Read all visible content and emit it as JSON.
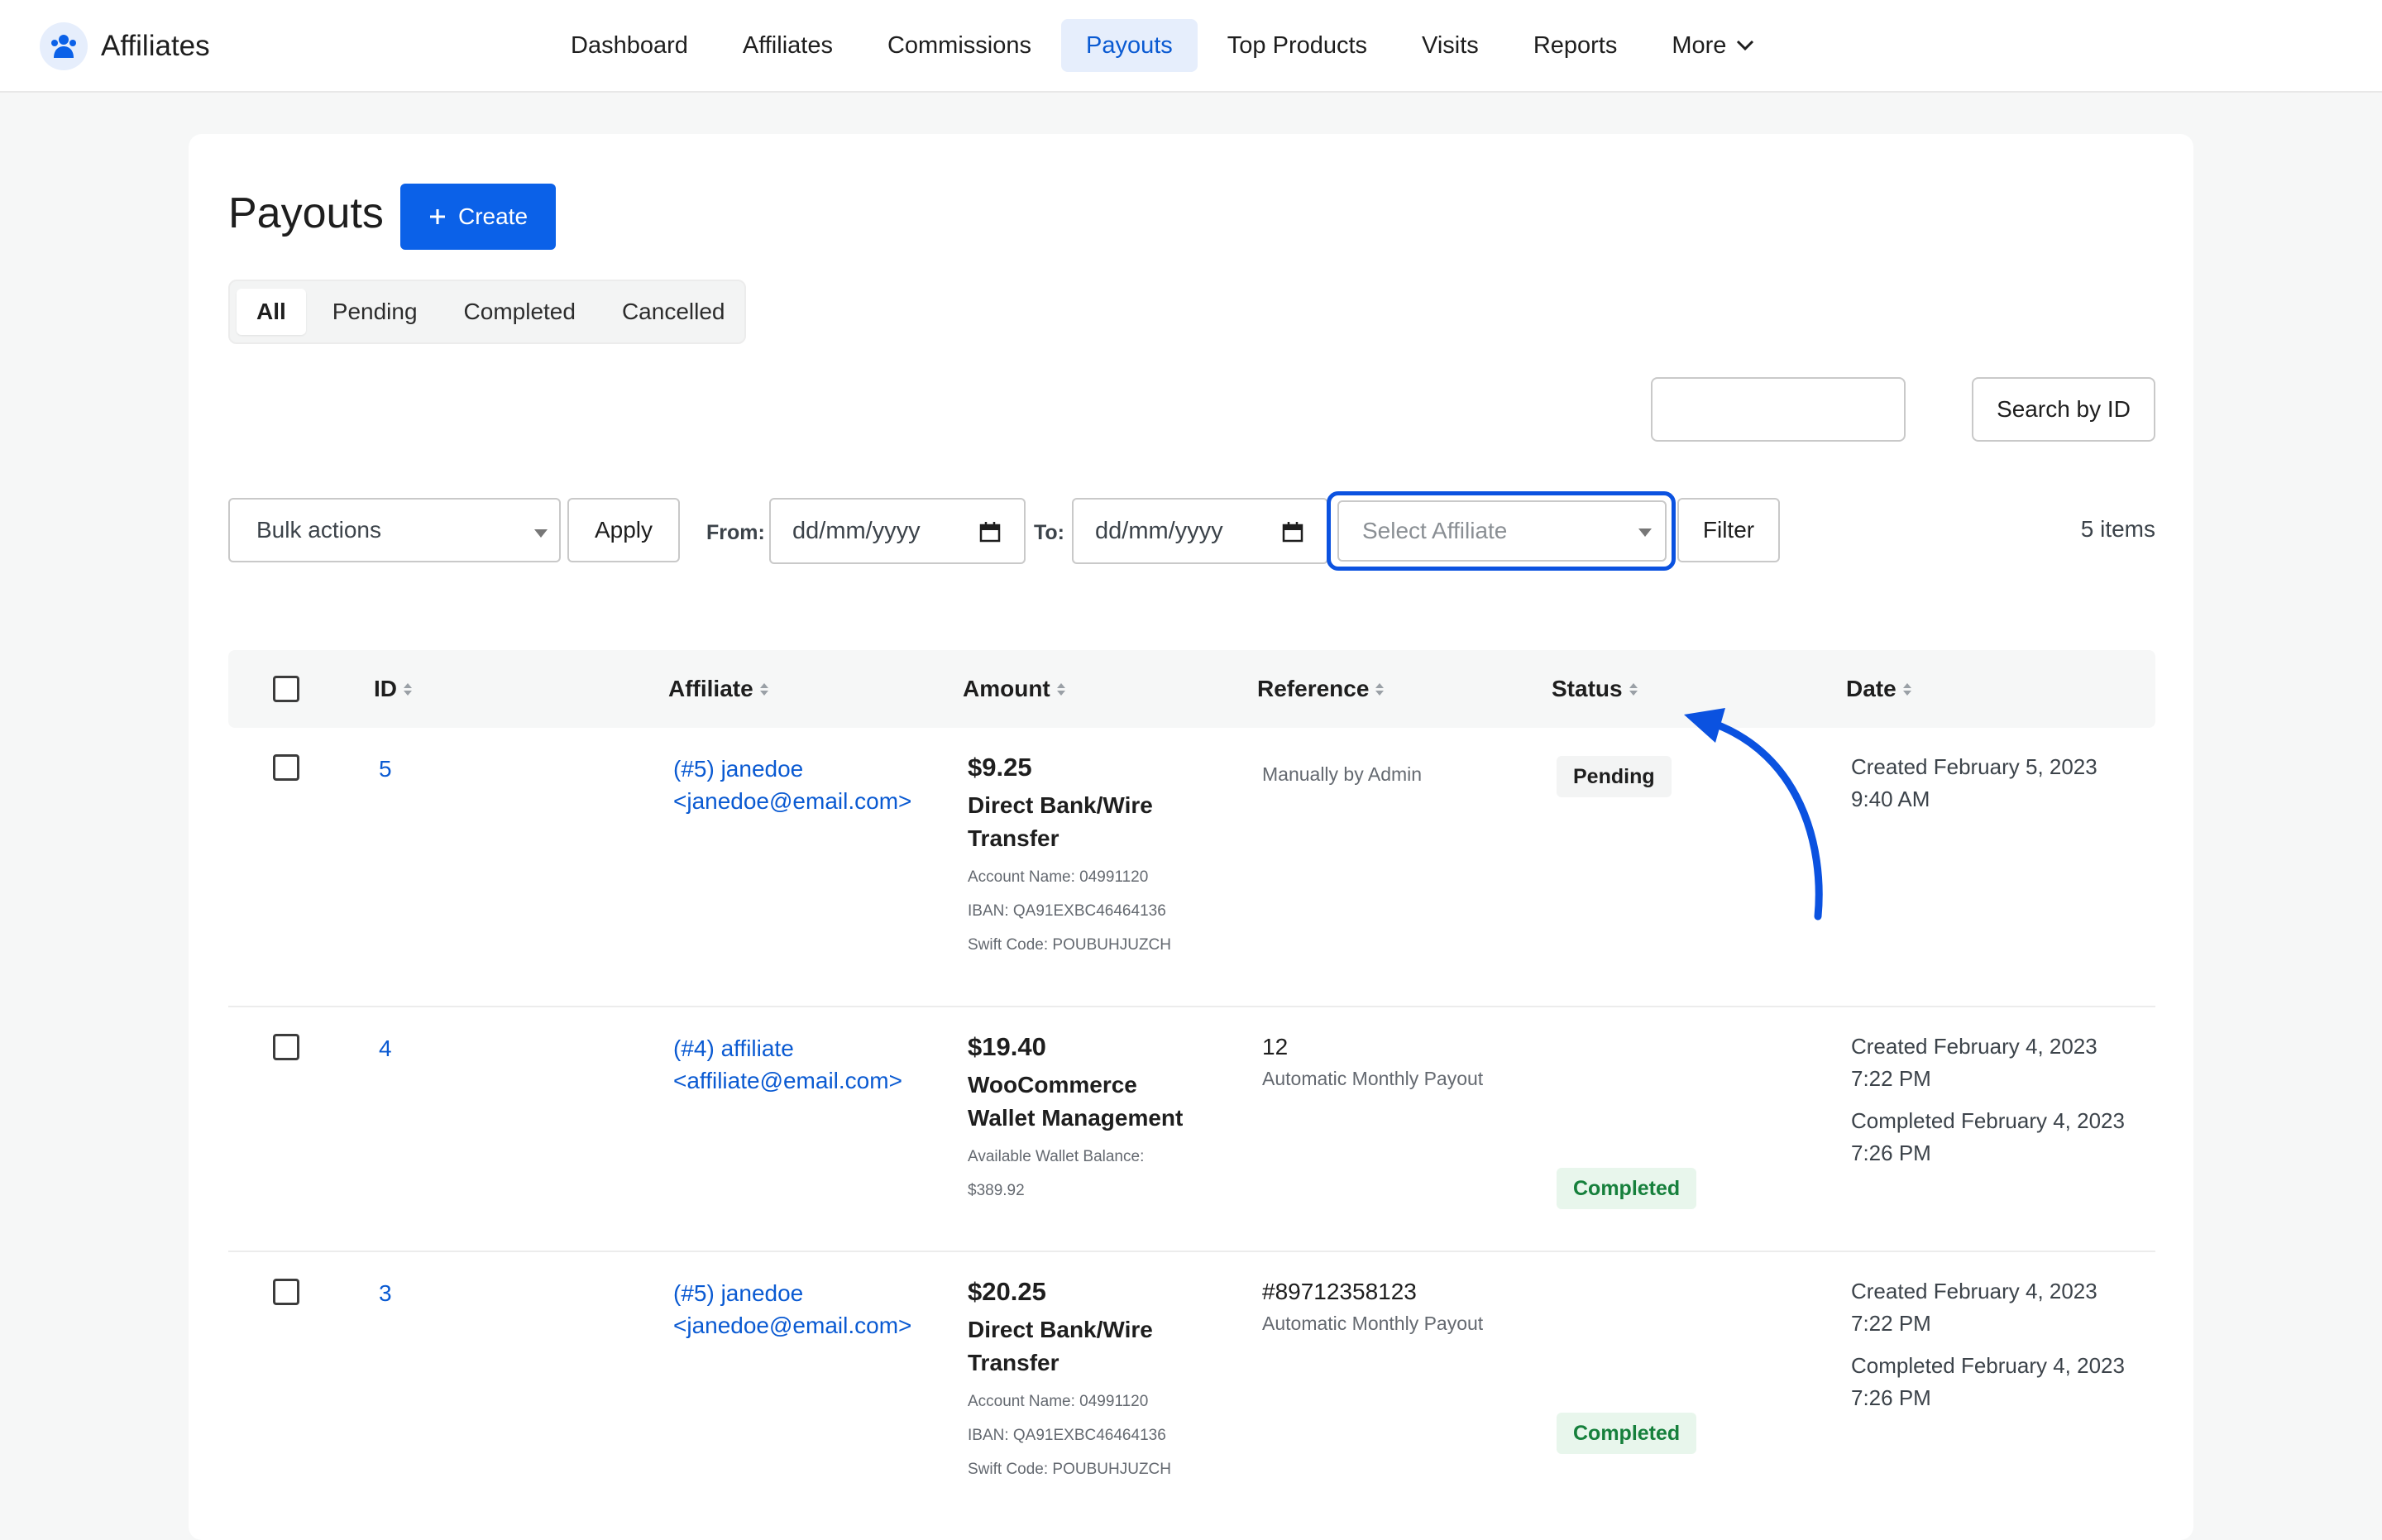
{
  "app": {
    "name": "Affiliates"
  },
  "nav": {
    "items": [
      "Dashboard",
      "Affiliates",
      "Commissions",
      "Payouts",
      "Top Products",
      "Visits",
      "Reports",
      "More"
    ],
    "active": "Payouts"
  },
  "page": {
    "title": "Payouts",
    "create_label": "Create"
  },
  "tabs": [
    "All",
    "Pending",
    "Completed",
    "Cancelled"
  ],
  "search": {
    "value": "",
    "button_label": "Search by ID"
  },
  "filters": {
    "bulk_actions": "Bulk actions",
    "apply": "Apply",
    "from_label": "From:",
    "from_placeholder": "dd/mm/yyyy",
    "to_label": "To:",
    "to_placeholder": "dd/mm/yyyy",
    "affiliate_placeholder": "Select Affiliate",
    "filter": "Filter",
    "items_count": "5 items"
  },
  "table": {
    "columns": [
      "ID",
      "Affiliate",
      "Amount",
      "Reference",
      "Status",
      "Date"
    ],
    "rows": [
      {
        "id": "5",
        "affiliate_line1": "(#5) janedoe",
        "affiliate_line2": "<janedoe@email.com>",
        "amount": "$9.25",
        "method_line1": "Direct Bank/Wire",
        "method_line2": "Transfer",
        "meta": [
          "Account Name: 04991120",
          "IBAN: QA91EXBC46464136",
          "Swift Code: POUBUHJUZCH"
        ],
        "ref_main": "",
        "ref_sub": "Manually by Admin",
        "status": "Pending",
        "date": [
          "Created February 5, 2023",
          "9:40 AM"
        ]
      },
      {
        "id": "4",
        "affiliate_line1": "(#4) affiliate",
        "affiliate_line2": "<affiliate@email.com>",
        "amount": "$19.40",
        "method_line1": "WooCommerce",
        "method_line2": "Wallet Management",
        "meta": [
          "Available Wallet Balance:",
          "$389.92"
        ],
        "ref_main": "12",
        "ref_sub": "Automatic Monthly Payout",
        "status": "Completed",
        "date": [
          "Created February 4, 2023",
          "7:22 PM",
          "Completed February 4, 2023",
          "7:26 PM"
        ]
      },
      {
        "id": "3",
        "affiliate_line1": "(#5) janedoe",
        "affiliate_line2": "<janedoe@email.com>",
        "amount": "$20.25",
        "method_line1": "Direct Bank/Wire",
        "method_line2": "Transfer",
        "meta": [
          "Account Name: 04991120",
          "IBAN: QA91EXBC46464136",
          "Swift Code: POUBUHJUZCH"
        ],
        "ref_main": "#89712358123",
        "ref_sub": "Automatic Monthly Payout",
        "status": "Completed",
        "date": [
          "Created February 4, 2023",
          "7:22 PM",
          "Completed February 4, 2023",
          "7:26 PM"
        ]
      }
    ]
  },
  "colors": {
    "accent": "#0b61e8",
    "highlight": "#0b52e0",
    "completed": "#16803c"
  }
}
